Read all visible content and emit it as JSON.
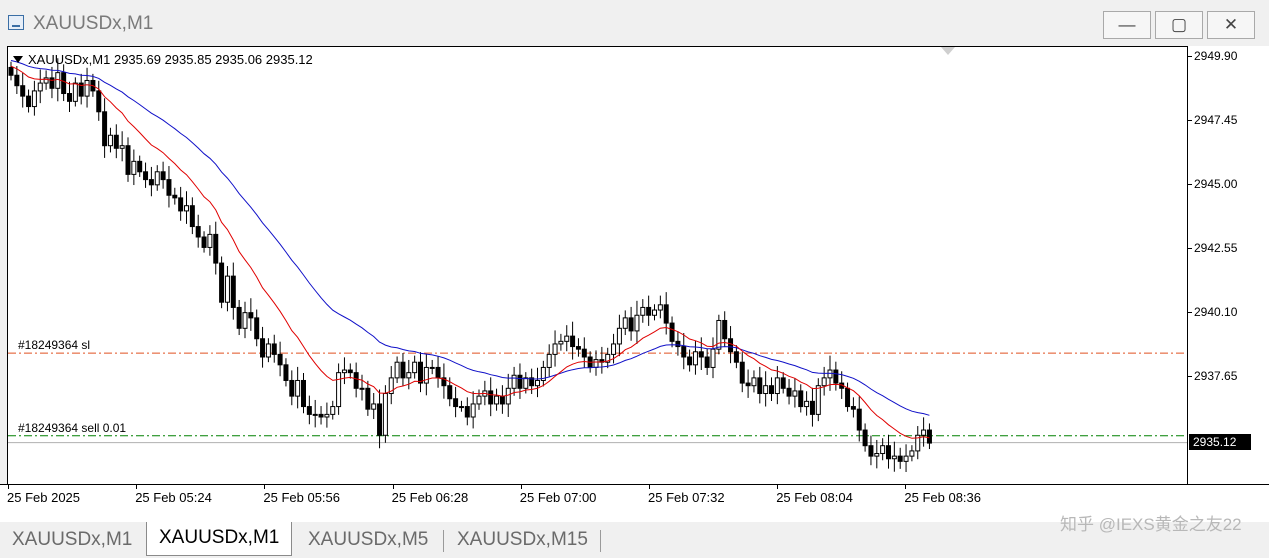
{
  "window": {
    "title": "XAUUSDx,M1",
    "minimize_label": "—",
    "maximize_label": "▢",
    "close_label": "✕"
  },
  "chart": {
    "symbol_line": "XAUUSDx,M1  2935.69 2935.85 2935.06 2935.12",
    "bull_color": "#000000",
    "bear_color": "#000000",
    "ma_fast_color": "#e00000",
    "ma_slow_color": "#1010c8",
    "sl_line_color": "#e05020",
    "order_line_color": "#008000",
    "orders": [
      {
        "label": "#18249364 sl",
        "price": 2938.55
      },
      {
        "label": "#18249364 sell 0.01",
        "price": 2935.38
      }
    ],
    "current_price": "2935.12"
  },
  "price_axis": {
    "labels": [
      "2949.90",
      "2947.45",
      "2945.00",
      "2942.55",
      "2940.10",
      "2937.65"
    ],
    "max": 2949.9,
    "min": 2933.8
  },
  "time_axis": {
    "labels": [
      "25 Feb 2025",
      "25 Feb 05:24",
      "25 Feb 05:56",
      "25 Feb 06:28",
      "25 Feb 07:00",
      "25 Feb 07:32",
      "25 Feb 08:04",
      "25 Feb 08:36"
    ]
  },
  "tabs": [
    {
      "label": "XAUUSDx,M1",
      "active": false
    },
    {
      "label": "XAUUSDx,M1",
      "active": true
    },
    {
      "label": "XAUUSDx,M5",
      "active": false
    },
    {
      "label": "XAUUSDx,M15",
      "active": false
    }
  ],
  "watermark": "知乎 @IEXS黄金之友22",
  "series": {
    "close": [
      2949.2,
      2948.8,
      2948.4,
      2948.0,
      2948.6,
      2948.9,
      2949.1,
      2948.7,
      2949.3,
      2948.5,
      2948.2,
      2948.9,
      2948.4,
      2949.0,
      2948.6,
      2947.8,
      2946.5,
      2946.9,
      2946.4,
      2946.5,
      2945.4,
      2945.9,
      2945.5,
      2945.2,
      2945.0,
      2945.5,
      2945.2,
      2944.6,
      2944.5,
      2944.0,
      2944.2,
      2943.4,
      2943.0,
      2942.6,
      2943.1,
      2942.0,
      2940.5,
      2941.5,
      2940.3,
      2939.5,
      2940.1,
      2939.9,
      2939.1,
      2938.4,
      2938.9,
      2938.5,
      2938.1,
      2937.5,
      2936.9,
      2937.5,
      2936.5,
      2936.2,
      2936.2,
      2936.1,
      2936.2,
      2936.5,
      2937.8,
      2937.9,
      2937.8,
      2937.2,
      2937.2,
      2936.4,
      2936.6,
      2935.4,
      2937.0,
      2937.6,
      2938.2,
      2937.6,
      2937.8,
      2938.2,
      2937.4,
      2938.0,
      2938.0,
      2937.6,
      2937.3,
      2936.8,
      2936.5,
      2936.5,
      2936.1,
      2936.6,
      2936.9,
      2937.1,
      2936.6,
      2936.9,
      2936.6,
      2937.2,
      2937.7,
      2937.2,
      2937.6,
      2937.3,
      2937.5,
      2938.0,
      2938.5,
      2938.9,
      2939.0,
      2939.2,
      2938.8,
      2938.7,
      2938.4,
      2938.0,
      2938.3,
      2938.2,
      2938.5,
      2938.9,
      2939.5,
      2939.9,
      2939.4,
      2940.0,
      2940.3,
      2940.0,
      2940.2,
      2940.4,
      2939.7,
      2939.0,
      2938.8,
      2938.4,
      2938.1,
      2938.6,
      2938.4,
      2938.0,
      2938.7,
      2939.8,
      2939.1,
      2938.6,
      2938.2,
      2937.4,
      2937.3,
      2937.6,
      2937.0,
      2937.3,
      2937.0,
      2937.6,
      2937.2,
      2936.9,
      2937.1,
      2936.5,
      2936.7,
      2936.2,
      2937.3,
      2937.6,
      2937.9,
      2937.4,
      2937.2,
      2936.5,
      2936.4,
      2935.6,
      2935.0,
      2934.6,
      2934.7,
      2935.0,
      2934.5,
      2934.6,
      2934.4,
      2934.6,
      2934.8,
      2935.4,
      2935.6,
      2935.1
    ]
  }
}
